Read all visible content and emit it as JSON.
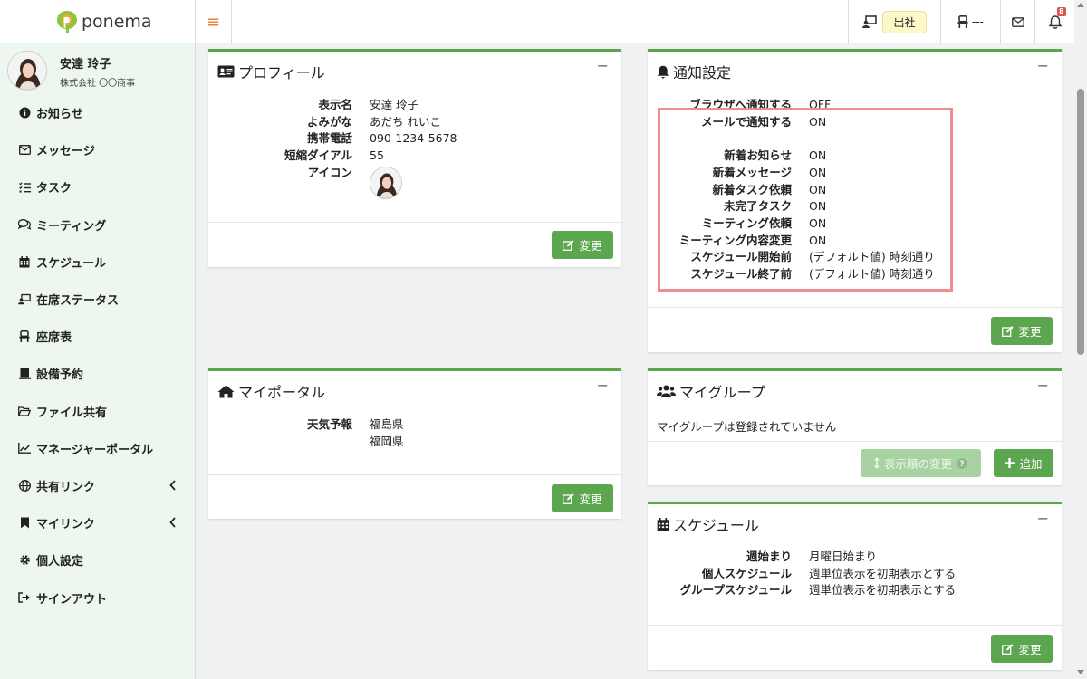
{
  "header": {
    "brand": "ponema",
    "status_label": "出社",
    "seat_label": "---",
    "notif_count": "8"
  },
  "user": {
    "name": "安達 玲子",
    "company": "株式会社 〇〇商事"
  },
  "nav": [
    {
      "label": "お知らせ",
      "icon": "info-icon"
    },
    {
      "label": "メッセージ",
      "icon": "envelope-icon"
    },
    {
      "label": "タスク",
      "icon": "task-list-icon"
    },
    {
      "label": "ミーティング",
      "icon": "chat-bubbles-icon"
    },
    {
      "label": "スケジュール",
      "icon": "calendar-icon"
    },
    {
      "label": "在席ステータス",
      "icon": "presence-icon"
    },
    {
      "label": "座席表",
      "icon": "chair-icon"
    },
    {
      "label": "設備予約",
      "icon": "facility-icon"
    },
    {
      "label": "ファイル共有",
      "icon": "folder-icon"
    },
    {
      "label": "マネージャーポータル",
      "icon": "chart-line-icon"
    },
    {
      "label": "共有リンク",
      "icon": "globe-icon"
    },
    {
      "label": "マイリンク",
      "icon": "bookmark-icon"
    },
    {
      "label": "個人設定",
      "icon": "gear-icon"
    },
    {
      "label": "サインアウト",
      "icon": "sign-out-icon"
    }
  ],
  "profile": {
    "title": "プロフィール",
    "rows": [
      {
        "k": "表示名",
        "v": "安達 玲子"
      },
      {
        "k": "よみがな",
        "v": "あだち れいこ"
      },
      {
        "k": "携帯電話",
        "v": "090-1234-5678"
      },
      {
        "k": "短縮ダイアル",
        "v": "55"
      },
      {
        "k": "アイコン",
        "v": ""
      }
    ],
    "button": "変更"
  },
  "notify": {
    "title": "通知設定",
    "rows": [
      {
        "k": "ブラウザへ通知する",
        "v": "OFF"
      },
      {
        "k": "メールで通知する",
        "v": "ON"
      },
      {
        "k": "",
        "v": ""
      },
      {
        "k": "新着お知らせ",
        "v": "ON"
      },
      {
        "k": "新着メッセージ",
        "v": "ON"
      },
      {
        "k": "新着タスク依頼",
        "v": "ON"
      },
      {
        "k": "未完了タスク",
        "v": "ON"
      },
      {
        "k": "ミーティング依頼",
        "v": "ON"
      },
      {
        "k": "ミーティング内容変更",
        "v": "ON"
      },
      {
        "k": "スケジュール開始前",
        "v": "(デフォルト値) 時刻通り"
      },
      {
        "k": "スケジュール終了前",
        "v": "(デフォルト値) 時刻通り"
      }
    ],
    "button": "変更"
  },
  "portal": {
    "title": "マイポータル",
    "rows": [
      {
        "k": "天気予報",
        "v": "福島県"
      },
      {
        "k": "",
        "v": "福岡県"
      }
    ],
    "button": "変更"
  },
  "group": {
    "title": "マイグループ",
    "empty": "マイグループは登録されていません",
    "reorder": "表示順の変更",
    "add": "追加"
  },
  "schedule": {
    "title": "スケジュール",
    "rows": [
      {
        "k": "週始まり",
        "v": "月曜日始まり"
      },
      {
        "k": "個人スケジュール",
        "v": "週単位表示を初期表示とする"
      },
      {
        "k": "グループスケジュール",
        "v": "週単位表示を初期表示とする"
      }
    ],
    "button": "変更"
  },
  "colors": {
    "accent": "#5ba64e",
    "highlight": "#f08c8f",
    "sidebar_bg": "#edf6ef",
    "badge_bg": "#fcf8c7"
  }
}
